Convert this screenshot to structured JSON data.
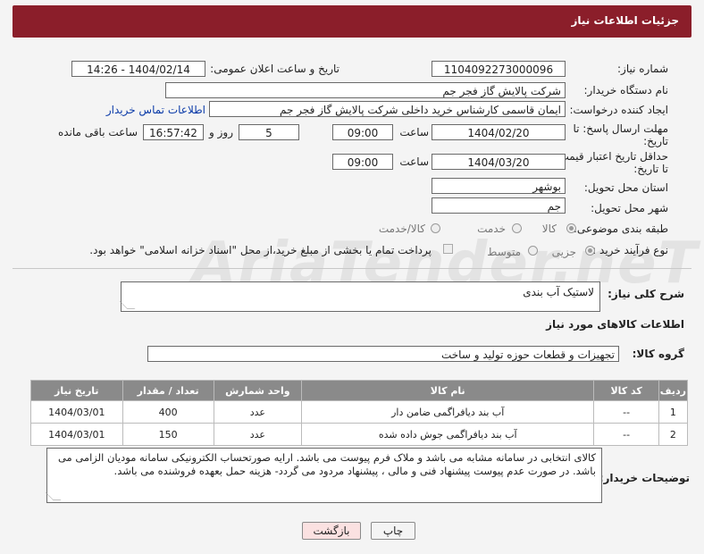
{
  "header": {
    "title": "جزئیات اطلاعات نیاز"
  },
  "fields": {
    "need_number_label": "شماره نیاز:",
    "need_number": "1104092273000096",
    "announce_label": "تاریخ و ساعت اعلان عمومی:",
    "announce_value": "1404/02/14 - 14:26",
    "buyer_org_label": "نام دستگاه خریدار:",
    "buyer_org": "شرکت پالایش گاز فجر جم",
    "requester_label": "ایجاد کننده درخواست:",
    "requester": "ایمان قاسمی کارشناس خرید داخلی شرکت پالایش گاز فجر جم",
    "contact_link": "اطلاعات تماس خریدار",
    "deadline_label_1": "مهلت ارسال پاسخ: تا",
    "deadline_label_2": "تاریخ:",
    "deadline_date": "1404/02/20",
    "time_label": "ساعت",
    "deadline_time": "09:00",
    "days_value": "5",
    "days_label": "روز و",
    "remaining_time": "16:57:42",
    "remaining_label": "ساعت باقی مانده",
    "validity_label_1": "حداقل تاریخ اعتبار قیمت:",
    "validity_label_2": "تا تاریخ:",
    "validity_date": "1404/03/20",
    "validity_time": "09:00",
    "province_label": "استان محل تحویل:",
    "province": "بوشهر",
    "city_label": "شهر محل تحویل:",
    "city": "جم",
    "category_label": "طبقه بندی موضوعی:",
    "category_options": [
      "کالا",
      "خدمت",
      "کالا/خدمت"
    ],
    "process_label": "نوع فرآیند خرید :",
    "process_options": [
      "جزیی",
      "متوسط"
    ],
    "payment_note": "پرداخت تمام یا بخشی از مبلغ خرید،از محل \"اسناد خزانه اسلامی\" خواهد بود.",
    "description_label": "شرح کلی نیاز:",
    "description": "لاستیک آب بندی",
    "goods_info_title": "اطلاعات کالاهای مورد نیاز",
    "goods_group_label": "گروه کالا:",
    "goods_group": "تجهیزات و قطعات حوزه تولید و ساخت"
  },
  "table": {
    "headers": [
      "ردیف",
      "کد کالا",
      "نام کالا",
      "واحد شمارش",
      "تعداد / مقدار",
      "تاریخ نیاز"
    ],
    "rows": [
      [
        "1",
        "--",
        "آب بند دیافراگمی ضامن دار",
        "عدد",
        "400",
        "1404/03/01"
      ],
      [
        "2",
        "--",
        "آب بند دیافراگمی جوش داده شده",
        "عدد",
        "150",
        "1404/03/01"
      ]
    ]
  },
  "buyer_notes_label": "توضیحات خریدار:",
  "buyer_notes": "کالای انتخابی در سامانه مشابه می باشد و ملاک فرم پیوست می باشد.  ارایه صورتحساب الکترونیکی سامانه مودیان الزامی می باشد. در صورت عدم پیوست پیشنهاد فنی و مالی ، پیشنهاد مردود می گردد- هزینه حمل بعهده فروشنده می باشد.",
  "buttons": {
    "print": "چاپ",
    "back": "بازگشت"
  },
  "watermark": "AriaTender.neT",
  "colors": {
    "header_bg": "#8b1e2a",
    "table_header_bg": "#8a8a8a",
    "back_button_bg": "#fbe1e1"
  }
}
